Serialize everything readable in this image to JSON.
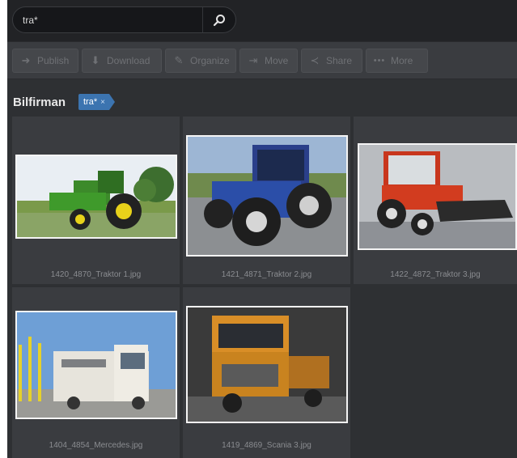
{
  "search": {
    "value": "tra*"
  },
  "toolbar": {
    "publish_label": "Publish",
    "download_label": "Download",
    "organize_label": "Organize",
    "move_label": "Move",
    "share_label": "Share",
    "more_label": "More"
  },
  "breadcrumb": {
    "title": "Bilfirman",
    "tag_label": "tra*",
    "tag_remove": "×"
  },
  "assets": [
    {
      "filename": "1420_4870_Traktor 1.jpg"
    },
    {
      "filename": "1421_4871_Traktor 2.jpg"
    },
    {
      "filename": "1422_4872_Traktor 3.jpg"
    },
    {
      "filename": "1404_4854_Mercedes.jpg"
    },
    {
      "filename": "1419_4869_Scania 3.jpg"
    }
  ]
}
